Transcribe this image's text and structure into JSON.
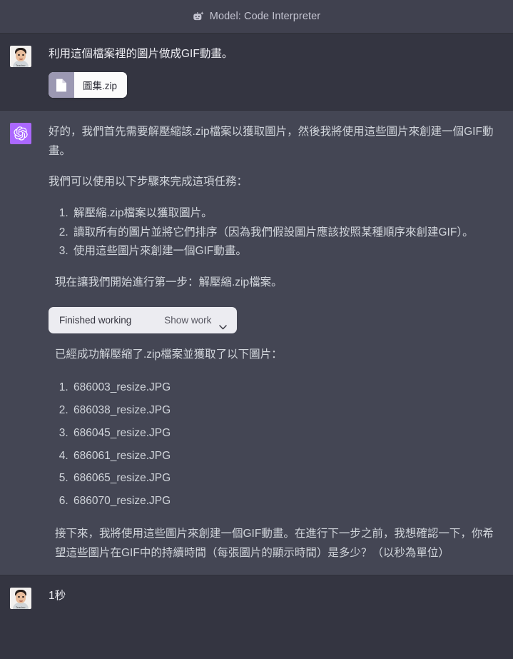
{
  "header": {
    "icon": "robot-beta-icon",
    "title": "Model: Code Interpreter"
  },
  "colors": {
    "user_bg": "#343541",
    "assistant_bg": "#444654",
    "header_bg": "#40414f",
    "assistant_avatar": "#ab68ff",
    "text_primary": "#ececf1",
    "text_secondary": "#d1d5db",
    "widget_bg": "#ececf1"
  },
  "turns": [
    {
      "role": "user",
      "avatar_caption": "Teacher",
      "text": "利用這個檔案裡的圖片做成GIF動畫。",
      "attachment": {
        "icon": "file-document-icon",
        "name": "圖集.zip"
      }
    },
    {
      "role": "assistant",
      "paragraph_1": "好的，我們首先需要解壓縮該.zip檔案以獲取圖片，然後我將使用這些圖片來創建一個GIF動畫。",
      "paragraph_2": "我們可以使用以下步驟來完成這項任務：",
      "steps": [
        "解壓縮.zip檔案以獲取圖片。",
        "讀取所有的圖片並將它們排序（因為我們假設圖片應該按照某種順序來創建GIF）。",
        "使用這些圖片來創建一個GIF動畫。"
      ],
      "paragraph_3": "現在讓我們開始進行第一步：解壓縮.zip檔案。",
      "work_widget": {
        "status_label": "Finished working",
        "action_label": "Show work",
        "chevron": "chevron-down-icon"
      },
      "paragraph_4": "已經成功解壓縮了.zip檔案並獲取了以下圖片：",
      "files": [
        "686003_resize.JPG",
        "686038_resize.JPG",
        "686045_resize.JPG",
        "686061_resize.JPG",
        "686065_resize.JPG",
        "686070_resize.JPG"
      ],
      "paragraph_5": "接下來，我將使用這些圖片來創建一個GIF動畫。在進行下一步之前，我想確認一下，你希望這些圖片在GIF中的持續時間（每張圖片的顯示時間）是多少？（以秒為單位）"
    },
    {
      "role": "user",
      "avatar_caption": "Teacher",
      "text": "1秒"
    }
  ]
}
